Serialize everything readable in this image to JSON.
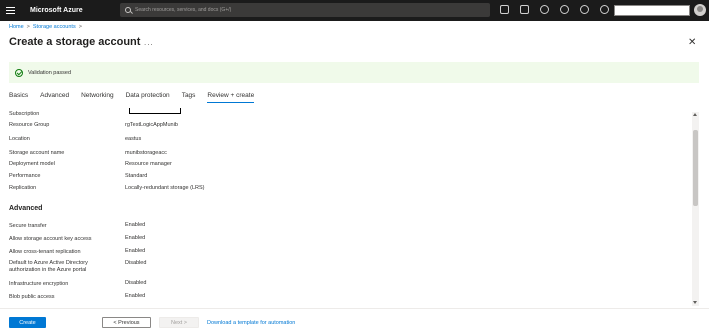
{
  "app": {
    "brand": "Microsoft Azure",
    "search_placeholder": "Search resources, services, and docs (G+/)"
  },
  "breadcrumb": {
    "items": [
      "Home",
      "Storage accounts"
    ],
    "separator": ">"
  },
  "page": {
    "title": "Create a storage account",
    "more": "...",
    "close": "✕"
  },
  "banner": {
    "text": "Validation passed",
    "status_color": "#107c10"
  },
  "tabs": [
    {
      "label": "Basics"
    },
    {
      "label": "Advanced"
    },
    {
      "label": "Networking"
    },
    {
      "label": "Data protection"
    },
    {
      "label": "Tags"
    },
    {
      "label": "Review + create",
      "active": true
    }
  ],
  "summary": {
    "basics": [
      {
        "label": "Subscription",
        "value": ""
      },
      {
        "label": "Resource Group",
        "value": "rgTestLogicAppMunib"
      },
      {
        "label": "Location",
        "value": "eastus"
      },
      {
        "label": "Storage account name",
        "value": "munibstorageacc"
      },
      {
        "label": "Deployment model",
        "value": "Resource manager"
      },
      {
        "label": "Performance",
        "value": "Standard"
      },
      {
        "label": "Replication",
        "value": "Locally-redundant storage (LRS)"
      }
    ],
    "advanced_heading": "Advanced",
    "advanced": [
      {
        "label": "Secure transfer",
        "value": "Enabled"
      },
      {
        "label": "Allow storage account key access",
        "value": "Enabled"
      },
      {
        "label": "Allow cross-tenant replication",
        "value": "Enabled"
      },
      {
        "label": "Default to Azure Active Directory authorization in the Azure portal",
        "value": "Disabled"
      },
      {
        "label": "Infrastructure encryption",
        "value": "Disabled"
      },
      {
        "label": "Blob public access",
        "value": "Enabled"
      }
    ]
  },
  "footer": {
    "create_label": "Create",
    "previous_label": "< Previous",
    "next_label": "Next >",
    "download_link": "Download a template for automation"
  },
  "colors": {
    "accent": "#0078d4",
    "topbar": "#1b1b1b",
    "banner_bg": "#f0faea"
  }
}
